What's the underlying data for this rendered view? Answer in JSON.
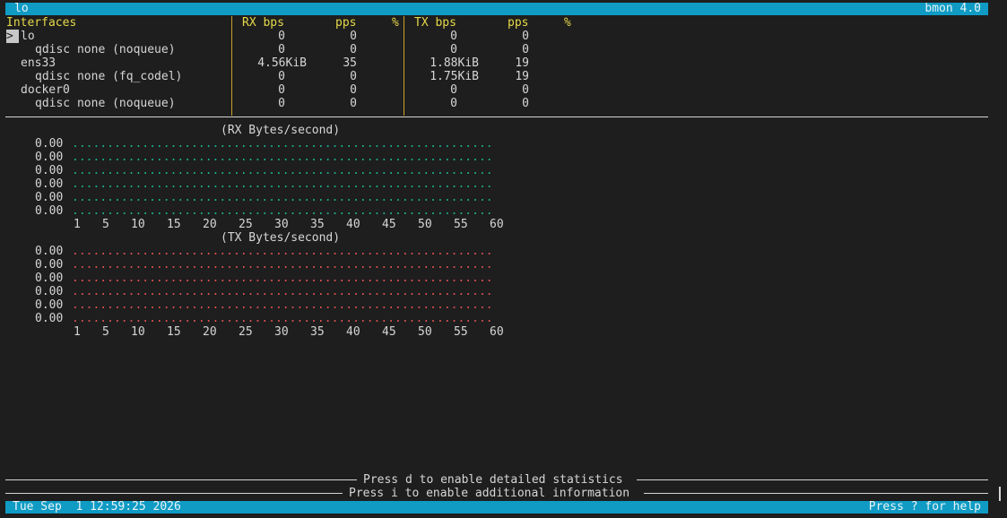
{
  "titlebar": {
    "left": "lo",
    "right": "bmon 4.0"
  },
  "table": {
    "headers": {
      "interfaces": "Interfaces",
      "rx_bps": "RX bps",
      "rx_pps": "pps",
      "rx_pct": "%",
      "tx_bps": "TX bps",
      "tx_pps": "pps",
      "tx_pct": "%"
    },
    "cursor": ">",
    "rows": [
      {
        "name": "lo",
        "rx_bps": "0",
        "rx_pps": "0",
        "tx_bps": "0",
        "tx_pps": "0"
      },
      {
        "name": "qdisc none (noqueue)",
        "rx_bps": "0",
        "rx_pps": "0",
        "tx_bps": "0",
        "tx_pps": "0"
      },
      {
        "name": "ens33",
        "rx_bps": "4.56KiB",
        "rx_pps": "35",
        "tx_bps": "1.88KiB",
        "tx_pps": "19"
      },
      {
        "name": "qdisc none (fq_codel)",
        "rx_bps": "0",
        "rx_pps": "0",
        "tx_bps": "1.75KiB",
        "tx_pps": "19"
      },
      {
        "name": "docker0",
        "rx_bps": "0",
        "rx_pps": "0",
        "tx_bps": "0",
        "tx_pps": "0"
      },
      {
        "name": "qdisc none (noqueue)",
        "rx_bps": "0",
        "rx_pps": "0",
        "tx_bps": "0",
        "tx_pps": "0"
      }
    ]
  },
  "graphs": {
    "rx": {
      "title": "(RX Bytes/second)",
      "y_labels": [
        "0.00",
        "0.00",
        "0.00",
        "0.00",
        "0.00",
        "0.00"
      ],
      "color": "#19b08c"
    },
    "tx": {
      "title": "(TX Bytes/second)",
      "y_labels": [
        "0.00",
        "0.00",
        "0.00",
        "0.00",
        "0.00",
        "0.00"
      ],
      "color": "#e05050"
    },
    "x_ticks": [
      "1",
      "5",
      "10",
      "15",
      "20",
      "25",
      "30",
      "35",
      "40",
      "45",
      "50",
      "55",
      "60"
    ]
  },
  "footer": {
    "msg_detailed": "Press d to enable detailed statistics",
    "msg_info": "Press i to enable additional information"
  },
  "statusbar": {
    "datetime": "Tue Sep  1 12:59:25 2026",
    "help": "Press ? for help"
  }
}
